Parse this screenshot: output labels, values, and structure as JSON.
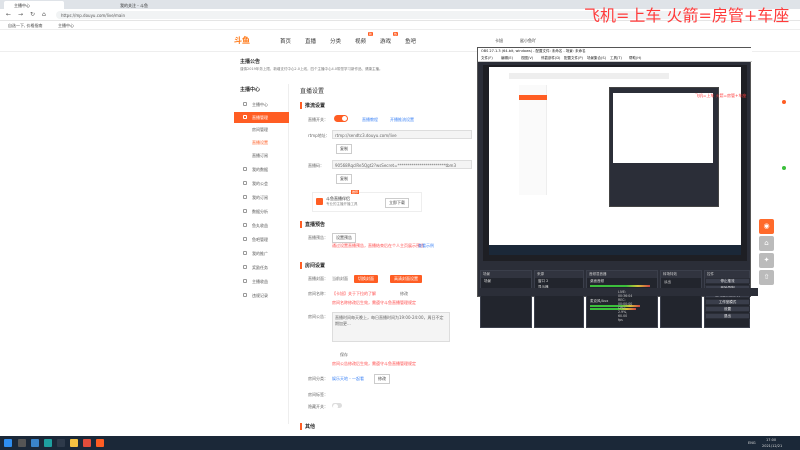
{
  "browser": {
    "tabs": [
      "主播中心",
      "我的关注 - 斗鱼"
    ],
    "url": "https://mp.douyu.com/live/main",
    "bookmarks": [
      "自选一下, 价格指南",
      "主播中心"
    ],
    "user_label": "卡旭",
    "user_name": "鲨小鱼吖"
  },
  "site": {
    "logo_text": "斗鱼",
    "nav": [
      "首页",
      "直播",
      "分类",
      "视频",
      "游戏",
      "鱼吧"
    ],
    "nav_badges": [
      "新",
      "热"
    ]
  },
  "notice": {
    "title": "主播公告",
    "text": "谨慎2019年务上限，新增支付中心2.0上线，四个主播中心4.0带您学习新作品、健康主播。"
  },
  "sidebar": {
    "header": "主播中心",
    "items": [
      "主播中心",
      "直播管理",
      "房间管理",
      "直播设置",
      "直播订阅",
      "我的数据",
      "我的公会",
      "我的订阅",
      "数据分析",
      "鱼丸收益",
      "鱼吧管理",
      "我的推广",
      "奖励任务",
      "主播收益",
      "违规记录"
    ]
  },
  "main": {
    "page_title": "直播设置",
    "push": {
      "section": "推流设置",
      "live_switch_label": "直播开关：",
      "link1": "直播教程",
      "link2": "开播推流设置",
      "rtmp_label": "rtmp地址：",
      "rtmp_value": "rtmp://sendtc3.douyu.com/live",
      "copy": "复制",
      "code_label": "直播码：",
      "code_value": "90568RqcIRe5Qgt2?wsSecret=************************tbm3",
      "copy2": "复制",
      "app_title": "斗鱼直播伴侣",
      "app_sub": "专业的主播开播工具",
      "app_badge": "推荐",
      "download": "立即下载"
    },
    "preview": {
      "section": "直播预告",
      "label": "直播预告：",
      "btn": "设置预告",
      "desc": "通过设置直播预告，直播结束后在个人主页展示预告",
      "link": "查看示例"
    },
    "room": {
      "section": "房间设置",
      "cover_label": "直播封面：",
      "cover_val": "当前封面",
      "cover_btn1": "切换封面",
      "cover_btn2": "高清封面设置",
      "name_label": "房间名称：",
      "name_val": "【卡旭】关于下拉的了解",
      "edit": "修改",
      "name_hint": "房间名称修改后生效，需遵守斗鱼直播管理规定",
      "notice_label": "房间公告：",
      "notice_val": "直播时间每天晚上，每日直播时间为19:00-24:00，周日不定期加更...",
      "save": "保存",
      "notice_hint": "房间公告修改后生效，需遵守斗鱼直播管理规定",
      "cat_label": "房间分类：",
      "cat_val": "娱乐天地 - 一起看",
      "cat_btn": "修改",
      "tag_label": "房间标签：",
      "hide_label": "隐藏开关："
    },
    "other_section": "其他"
  },
  "obs": {
    "title": "OBS 27.1.3 (64-bit, windows) - 配置文件: 未命名 - 场景: 未命名",
    "menu": [
      "文件(F)",
      "编辑(E)",
      "视图(V)",
      "停靠部件(D)",
      "配置文件(P)",
      "场景集合(S)",
      "工具(T)",
      "帮助(H)"
    ],
    "docks": [
      "场景",
      "来源",
      "音频混音器",
      "转场特效",
      "控件"
    ],
    "scene": "场景",
    "sources": [
      "窗口 2",
      "显示器",
      "显示器采集"
    ],
    "mixer": [
      "桌面音频",
      "麦克风/Aux"
    ],
    "transition": "淡出",
    "duration_label": "时长",
    "duration": "300 ms",
    "controls": [
      "停止推流",
      "开始录制",
      "启动虚拟摄像机",
      "工作室模式",
      "设置",
      "退出"
    ],
    "status": "LIVE: 00:36:04  REC: 00:00:00  CPU: 2.9%, 60.00 fps"
  },
  "overlay_text": "飞机=上车  火箭=房管+车座",
  "taskbar": {
    "time": "17:00",
    "date": "2021/12/21",
    "lang": "ENG"
  },
  "colors": {
    "accent": "#ff5d23",
    "overlay": "#ff3b3b",
    "obs_bg": "#2b2e38"
  }
}
